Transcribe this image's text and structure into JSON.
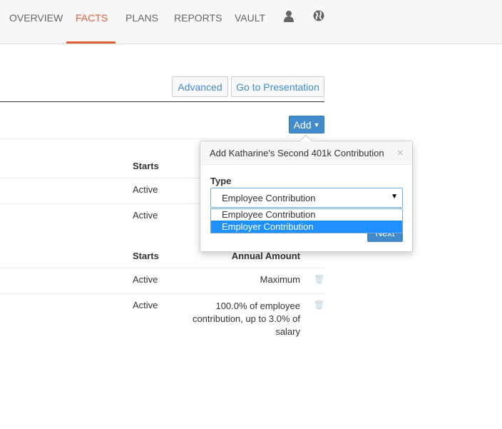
{
  "nav": {
    "items": [
      {
        "label": "OVERVIEW"
      },
      {
        "label": "FACTS",
        "active": true
      },
      {
        "label": "PLANS"
      },
      {
        "label": "REPORTS"
      },
      {
        "label": "VAULT"
      }
    ],
    "icons": [
      "user-icon",
      "globe-icon"
    ],
    "accent": "#e0603a"
  },
  "toolbar": {
    "advanced": "Advanced",
    "presentation": "Go to Presentation",
    "add": "Add"
  },
  "table1": {
    "header": "Starts",
    "rows": [
      "Active",
      "Active"
    ]
  },
  "table2": {
    "headers": [
      "Starts",
      "Annual Amount"
    ],
    "rows": [
      {
        "starts": "Active",
        "amount": "Maximum"
      },
      {
        "starts": "Active",
        "amount": "100.0% of employee contribution, up to 3.0% of salary"
      }
    ]
  },
  "popover": {
    "title": "Add Katharine's Second 401k Contribution",
    "close": "×",
    "type_label": "Type",
    "selected": "Employee Contribution",
    "options": [
      "Employee Contribution",
      "Employer Contribution"
    ],
    "highlighted": "Employer Contribution",
    "next": "Next"
  }
}
